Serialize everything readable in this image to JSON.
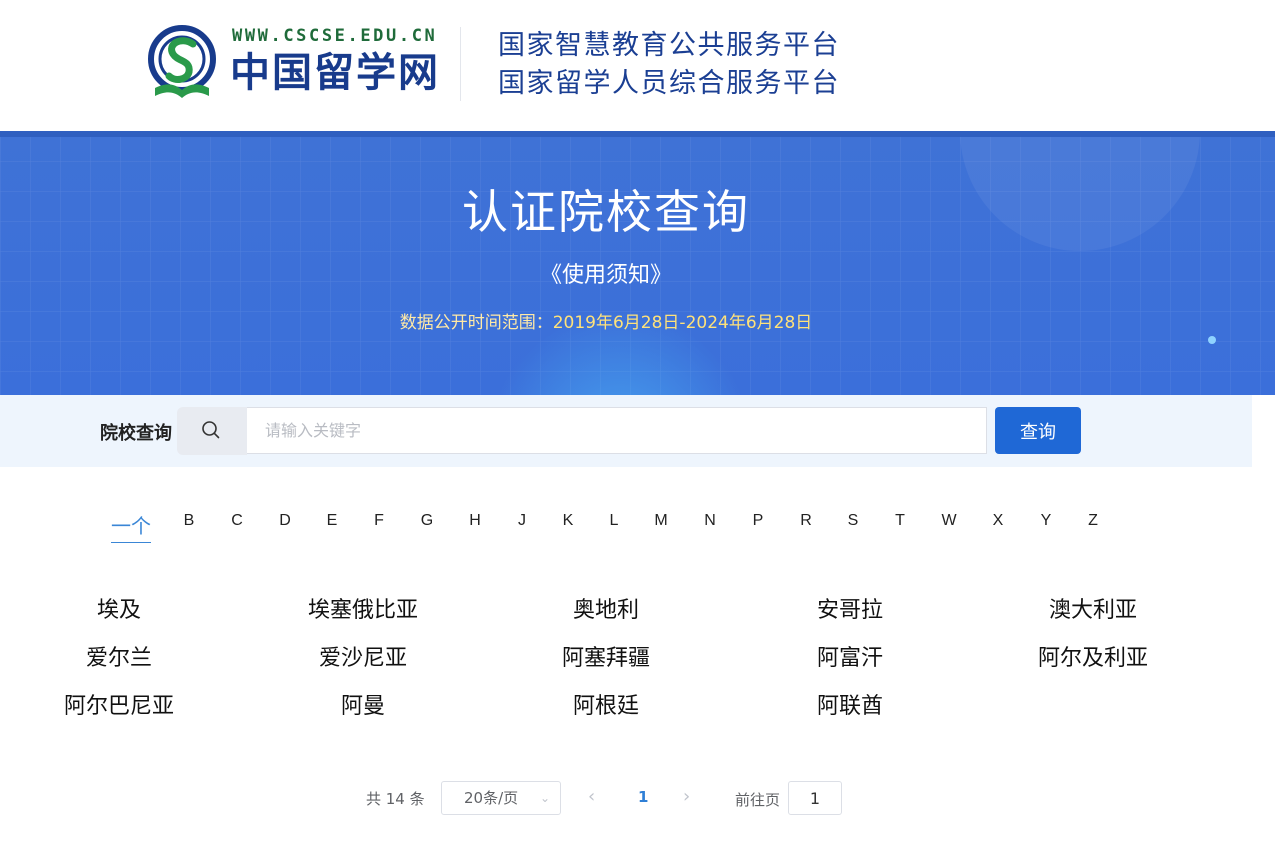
{
  "header": {
    "logo_url": "WWW.CSCSE.EDU.CN",
    "logo_name": "中国留学网",
    "platform_line1": "国家智慧教育公共服务平台",
    "platform_line2": "国家留学人员综合服务平台"
  },
  "banner": {
    "title": "认证院校查询",
    "notice": "《使用须知》",
    "range_label": "数据公开时间范围：",
    "range_value": "2019年6月28日-2024年6月28日"
  },
  "search": {
    "label": "院校查询",
    "placeholder": "请输入关键字",
    "button": "查询"
  },
  "letters": [
    "一个",
    "B",
    "C",
    "D",
    "E",
    "F",
    "G",
    "H",
    "J",
    "K",
    "L",
    "M",
    "N",
    "P",
    "R",
    "S",
    "T",
    "W",
    "X",
    "Y",
    "Z"
  ],
  "active_letter": "一个",
  "countries": [
    "埃及",
    "埃塞俄比亚",
    "奥地利",
    "安哥拉",
    "澳大利亚",
    "爱尔兰",
    "爱沙尼亚",
    "阿塞拜疆",
    "阿富汗",
    "阿尔及利亚",
    "阿尔巴尼亚",
    "阿曼",
    "阿根廷",
    "阿联酋"
  ],
  "pagination": {
    "total": "共 14 条",
    "page_size": "20条/页",
    "current_page": "1",
    "goto_label": "前往页",
    "goto_value": "1"
  },
  "colors": {
    "brand_blue": "#1b3f93",
    "banner_blue": "#3f72d6",
    "button_blue": "#1f68d6",
    "range_yellow": "#ffe27a"
  }
}
